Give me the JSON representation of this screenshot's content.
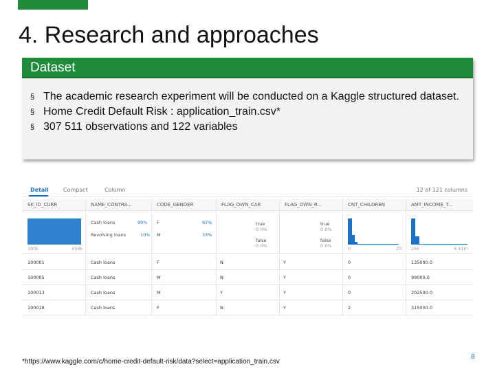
{
  "title": "4. Research and approaches",
  "box": {
    "header": "Dataset",
    "bullets": [
      "The academic research experiment will be conducted on a Kaggle structured dataset.",
      "Home Credit Default Risk : application_train.csv*",
      "307 511 observations and 122 variables"
    ],
    "bullet_mark": "§"
  },
  "kaggle": {
    "tabs": [
      "Detail",
      "Compact",
      "Column"
    ],
    "column_count": "12 of 121 columns",
    "columns": [
      "SK_ID_CURR",
      "NAME_CONTRA...",
      "CODE_GENDER",
      "FLAG_OWN_CAR",
      "FLAG_OWN_R...",
      "CNT_CHILDREN",
      "AMT_INCOME_T..."
    ],
    "stats": {
      "id_range": [
        "100k",
        "456k"
      ],
      "contract": [
        [
          "Cash loans",
          "90%"
        ],
        [
          "Revolving loans",
          "10%"
        ]
      ],
      "gender": [
        [
          "F",
          "67%"
        ],
        [
          "M",
          "33%"
        ]
      ],
      "car": [
        [
          "true",
          "0 0%"
        ],
        [
          "false",
          "0 0%"
        ]
      ],
      "realty": [
        [
          "true",
          "0 0%"
        ],
        [
          "false",
          "0 0%"
        ]
      ],
      "children_range": [
        "0",
        "20"
      ],
      "income_range": [
        "26k",
        "4.41m"
      ]
    },
    "rows": [
      [
        "100001",
        "Cash loans",
        "F",
        "N",
        "Y",
        "0",
        "135000.0"
      ],
      [
        "100005",
        "Cash loans",
        "M",
        "N",
        "Y",
        "0",
        "99000.0"
      ],
      [
        "100013",
        "Cash loans",
        "M",
        "Y",
        "Y",
        "0",
        "202500.0"
      ],
      [
        "100028",
        "Cash loans",
        "F",
        "N",
        "Y",
        "2",
        "315000.0"
      ]
    ]
  },
  "footnote": "*https://www.kaggle.com/c/home-credit-default-risk/data?select=application_train.csv",
  "page_number": "8",
  "colors": {
    "accent": "#1f8c3b",
    "kaggle_blue": "#1a73c8"
  }
}
